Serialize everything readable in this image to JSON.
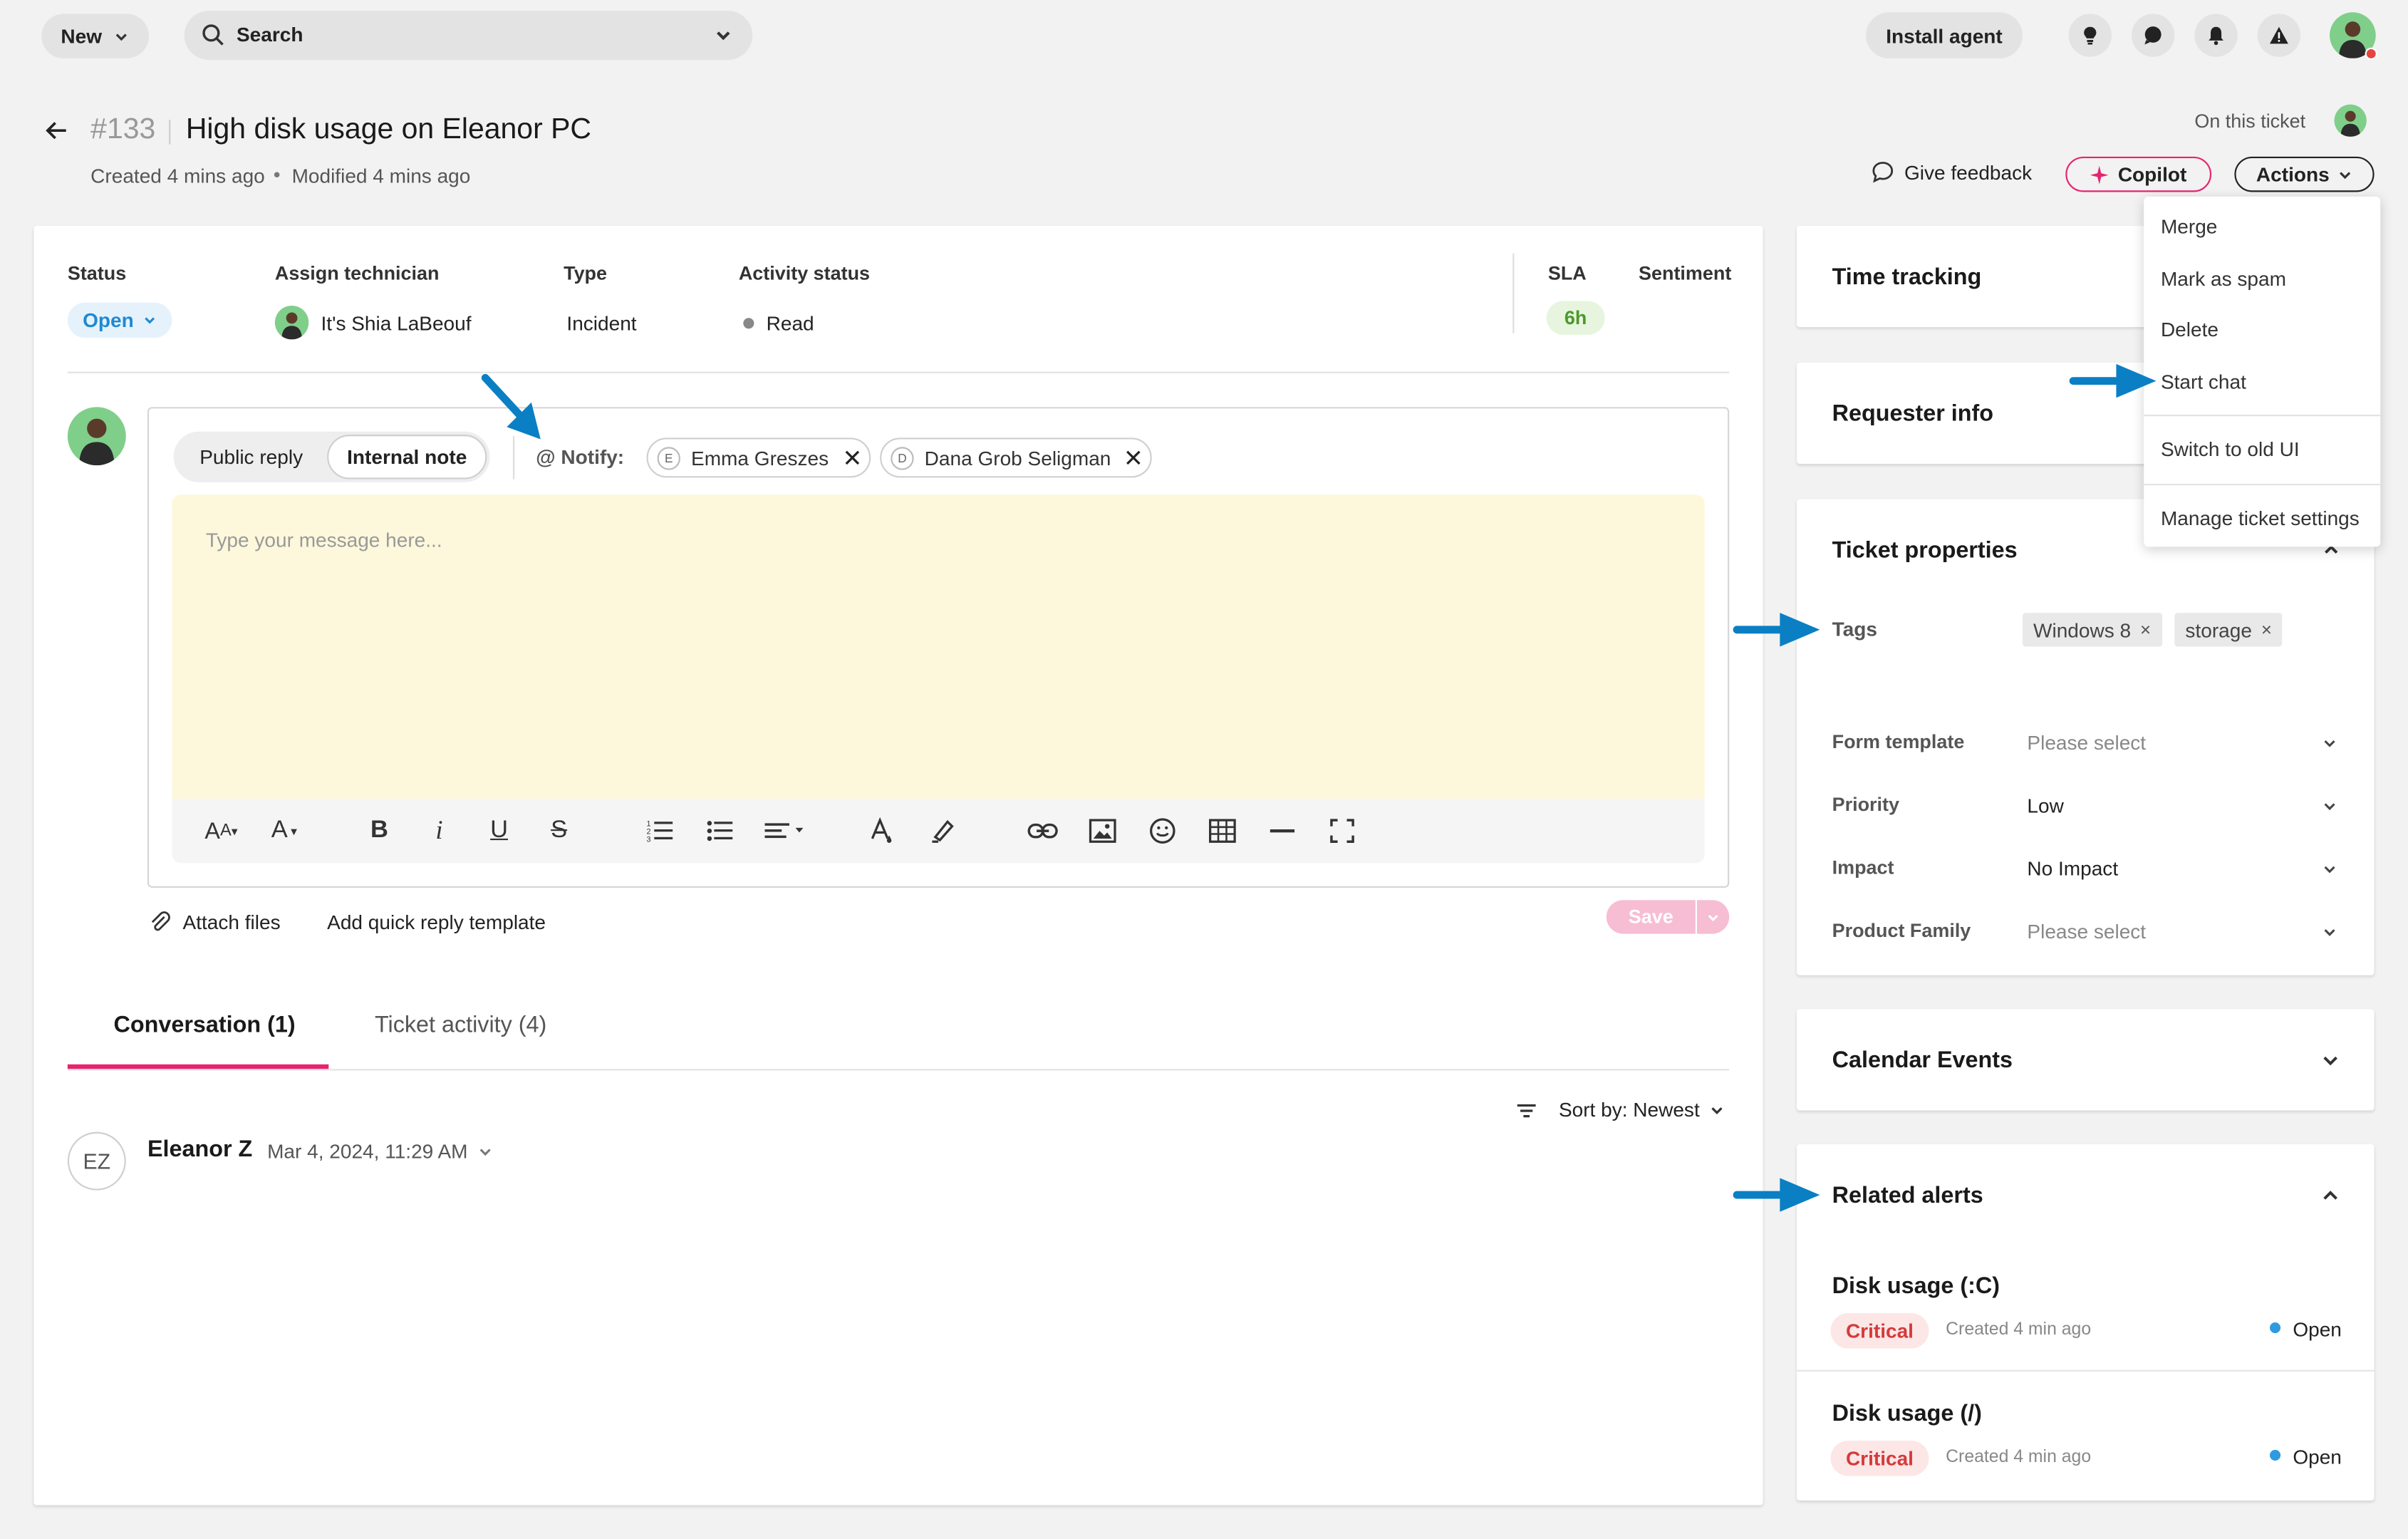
{
  "topbar": {
    "new_label": "New",
    "search_placeholder": "Search",
    "install_agent_label": "Install agent"
  },
  "ticket": {
    "number": "#133",
    "title": "High disk usage on Eleanor PC",
    "created": "Created 4 mins ago",
    "modified": "Modified 4 mins ago",
    "on_this_ticket": "On this ticket",
    "give_feedback": "Give feedback",
    "copilot": "Copilot",
    "actions": "Actions"
  },
  "fields": {
    "status_label": "Status",
    "status_value": "Open",
    "assign_label": "Assign technician",
    "assign_value": "It's Shia LaBeouf",
    "type_label": "Type",
    "type_value": "Incident",
    "activity_label": "Activity status",
    "activity_value": "Read",
    "sla_label": "SLA",
    "sla_value": "6h",
    "sentiment_label": "Sentiment"
  },
  "composer": {
    "public_reply": "Public reply",
    "internal_note": "Internal note",
    "notify_label": "@ Notify:",
    "notify_1": "Emma Greszes",
    "notify_1_initial": "E",
    "notify_2": "Dana Grob Seligman",
    "notify_2_initial": "D",
    "placeholder": "Type your message here...",
    "attach_files": "Attach files",
    "quick_reply": "Add quick reply template",
    "save": "Save"
  },
  "tabs": {
    "conversation": "Conversation (1)",
    "activity": "Ticket activity (4)",
    "sort": "Sort by: Newest"
  },
  "message": {
    "initials": "EZ",
    "author": "Eleanor Z",
    "date": "Mar 4, 2024, 11:29 AM"
  },
  "actions_menu": {
    "merge": "Merge",
    "spam": "Mark as spam",
    "delete": "Delete",
    "start_chat": "Start chat",
    "old_ui": "Switch to old UI",
    "manage": "Manage ticket settings"
  },
  "side": {
    "time_tracking": "Time tracking",
    "requester_info": "Requester info",
    "ticket_properties": "Ticket properties",
    "tags_label": "Tags",
    "tag_1": "Windows 8",
    "tag_2": "storage",
    "form_template_label": "Form template",
    "form_template_value": "Please select",
    "priority_label": "Priority",
    "priority_value": "Low",
    "impact_label": "Impact",
    "impact_value": "No Impact",
    "product_family_label": "Product Family",
    "product_family_value": "Please select",
    "calendar_events": "Calendar Events",
    "related_alerts": "Related alerts",
    "alert_1_title": "Disk usage (:C)",
    "alert_1_severity": "Critical",
    "alert_1_created": "Created 4 min ago",
    "alert_1_status": "Open",
    "alert_2_title": "Disk usage (/)",
    "alert_2_severity": "Critical",
    "alert_2_created": "Created 4 min ago",
    "alert_2_status": "Open"
  },
  "colors": {
    "accent_pink": "#e6246e",
    "arrow_blue": "#0a7fc4",
    "open_blue": "#e5f2fb",
    "critical_bg": "#fde6e6",
    "critical_text": "#d33b3b",
    "sla_green": "#e7f5df"
  }
}
